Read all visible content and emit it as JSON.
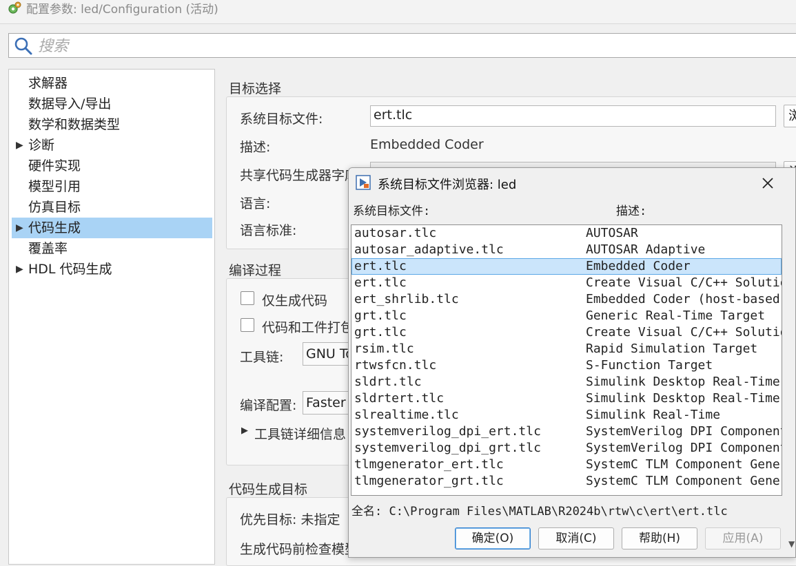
{
  "window": {
    "title": "配置参数: led/Configuration (活动)"
  },
  "search": {
    "placeholder": "搜索"
  },
  "tree": {
    "items": [
      {
        "label": "求解器",
        "expandable": false,
        "selected": false
      },
      {
        "label": "数据导入/导出",
        "expandable": false,
        "selected": false
      },
      {
        "label": "数学和数据类型",
        "expandable": false,
        "selected": false
      },
      {
        "label": "诊断",
        "expandable": true,
        "selected": false
      },
      {
        "label": "硬件实现",
        "expandable": false,
        "selected": false
      },
      {
        "label": "模型引用",
        "expandable": false,
        "selected": false
      },
      {
        "label": "仿真目标",
        "expandable": false,
        "selected": false
      },
      {
        "label": "代码生成",
        "expandable": true,
        "selected": true
      },
      {
        "label": "覆盖率",
        "expandable": false,
        "selected": false
      },
      {
        "label": "HDL 代码生成",
        "expandable": true,
        "selected": false
      }
    ]
  },
  "target_selection": {
    "title": "目标选择",
    "stf_label": "系统目标文件:",
    "stf_value": "ert.tlc",
    "browse_button_partial": "浏",
    "desc_label": "描述:",
    "desc_value": "Embedded Coder",
    "shared_label": "共享代码生成器字库",
    "shared_button_partial": "设",
    "lang_label": "语言:",
    "lang_std_label": "语言标准:"
  },
  "build_process": {
    "title": "编译过程",
    "gen_only_label": "仅生成代码",
    "package_label": "代码和工件打包",
    "toolchain_label": "工具链:",
    "toolchain_value": "GNU Tools",
    "build_config_label": "编译配置:",
    "build_config_value": "Faster Builds",
    "toolchain_details_label": "工具链详细信息"
  },
  "code_gen_objectives": {
    "title": "代码生成目标",
    "priority_label": "优先目标: 未指定",
    "check_label": "生成代码前检查模型"
  },
  "dialog": {
    "title": "系统目标文件浏览器: led",
    "col_file": "系统目标文件:",
    "col_desc": "描述:",
    "rows": [
      {
        "file": "autosar.tlc",
        "desc": "AUTOSAR"
      },
      {
        "file": "autosar_adaptive.tlc",
        "desc": "AUTOSAR Adaptive"
      },
      {
        "file": "ert.tlc",
        "desc": "Embedded Coder"
      },
      {
        "file": "ert.tlc",
        "desc": "Create Visual C/C++ Solution"
      },
      {
        "file": "ert_shrlib.tlc",
        "desc": "Embedded Coder (host-based shared library target)"
      },
      {
        "file": "grt.tlc",
        "desc": "Generic Real-Time Target"
      },
      {
        "file": "grt.tlc",
        "desc": "Create Visual C/C++ Solution"
      },
      {
        "file": "rsim.tlc",
        "desc": "Rapid Simulation Target"
      },
      {
        "file": "rtwsfcn.tlc",
        "desc": "S-Function Target"
      },
      {
        "file": "sldrt.tlc",
        "desc": "Simulink Desktop Real-Time"
      },
      {
        "file": "sldrtert.tlc",
        "desc": "Simulink Desktop Real-Time"
      },
      {
        "file": "slrealtime.tlc",
        "desc": "Simulink Real-Time"
      },
      {
        "file": "systemverilog_dpi_ert.tlc",
        "desc": "SystemVerilog DPI Component"
      },
      {
        "file": "systemverilog_dpi_grt.tlc",
        "desc": "SystemVerilog DPI Component"
      },
      {
        "file": "tlmgenerator_ert.tlc",
        "desc": "SystemC TLM Component Generator"
      },
      {
        "file": "tlmgenerator_grt.tlc",
        "desc": "SystemC TLM Component Generator"
      }
    ],
    "selected_index": 2,
    "fullname": "全名: C:\\Program Files\\MATLAB\\R2024b\\rtw\\c\\ert\\ert.tlc",
    "ok_label": "确定(O)",
    "cancel_label": "取消(C)",
    "help_label": "帮助(H)",
    "apply_label": "应用(A)"
  },
  "colors": {
    "tree_selection": "#a9d3f5",
    "list_selection": "#cbe5fb",
    "primary_border": "#2f7fcf"
  }
}
